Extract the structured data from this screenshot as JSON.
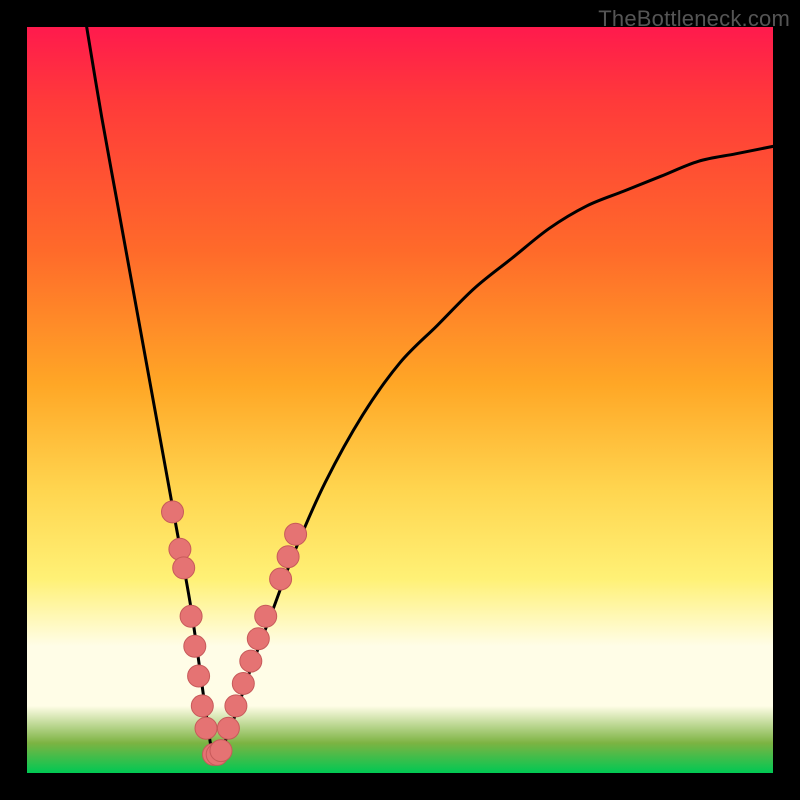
{
  "attribution": "TheBottleneck.com",
  "colors": {
    "frame": "#000000",
    "curve_stroke": "#000000",
    "marker_fill": "#e57373",
    "marker_stroke": "#c75a5a"
  },
  "chart_data": {
    "type": "line",
    "title": "",
    "xlabel": "",
    "ylabel": "",
    "xlim": [
      0,
      100
    ],
    "ylim": [
      0,
      100
    ],
    "x_min_curve": 8,
    "x_vertex": 25,
    "series": [
      {
        "name": "bottleneck-curve",
        "x": [
          8,
          10,
          12,
          14,
          16,
          18,
          20,
          22,
          24,
          25,
          26,
          28,
          30,
          33,
          36,
          40,
          45,
          50,
          55,
          60,
          65,
          70,
          75,
          80,
          85,
          90,
          95,
          100
        ],
        "y": [
          100,
          88,
          77,
          66,
          55,
          44,
          33,
          22,
          8,
          2,
          3,
          8,
          14,
          22,
          30,
          39,
          48,
          55,
          60,
          65,
          69,
          73,
          76,
          78,
          80,
          82,
          83,
          84
        ]
      }
    ],
    "markers": {
      "name": "highlighted-points",
      "x": [
        19.5,
        20.5,
        21,
        22,
        22.5,
        23,
        23.5,
        24,
        25,
        25.5,
        26,
        27,
        28,
        29,
        30,
        31,
        32,
        34,
        35,
        36
      ],
      "y": [
        35,
        30,
        27.5,
        21,
        17,
        13,
        9,
        6,
        2.5,
        2.5,
        3,
        6,
        9,
        12,
        15,
        18,
        21,
        26,
        29,
        32
      ]
    },
    "gradient_stops": [
      {
        "pos": 0.0,
        "color": "#ff1a4d"
      },
      {
        "pos": 0.3,
        "color": "#ff6a2a"
      },
      {
        "pos": 0.62,
        "color": "#ffd54f"
      },
      {
        "pos": 0.83,
        "color": "#fffde7"
      },
      {
        "pos": 0.96,
        "color": "#7cb342"
      },
      {
        "pos": 1.0,
        "color": "#00c853"
      }
    ]
  }
}
